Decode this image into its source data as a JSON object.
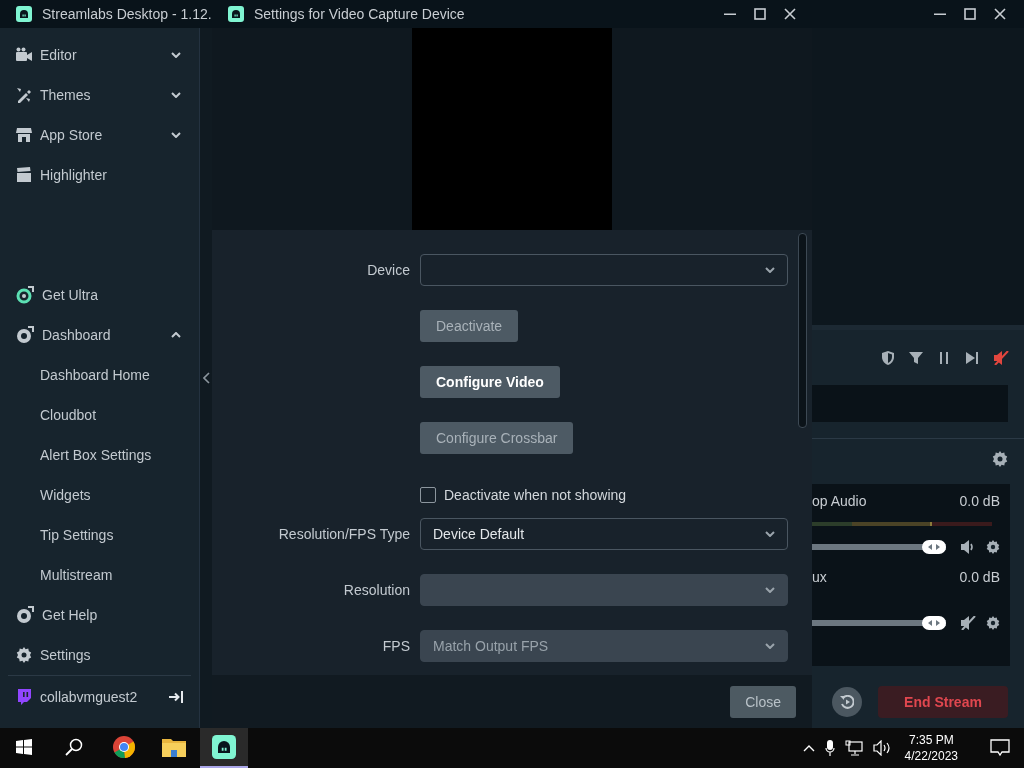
{
  "main_window": {
    "title": "Streamlabs Desktop - 1.12.",
    "sidebar": {
      "top_items": [
        {
          "label": "Editor",
          "expanded": false
        },
        {
          "label": "Themes",
          "expanded": false
        },
        {
          "label": "App Store",
          "expanded": false
        },
        {
          "label": "Highlighter"
        }
      ],
      "bottom_items": [
        {
          "label": "Get Ultra"
        },
        {
          "label": "Dashboard",
          "expanded": true,
          "children": [
            {
              "label": "Dashboard Home"
            },
            {
              "label": "Cloudbot"
            },
            {
              "label": "Alert Box Settings"
            },
            {
              "label": "Widgets"
            },
            {
              "label": "Tip Settings"
            },
            {
              "label": "Multistream"
            }
          ]
        },
        {
          "label": "Get Help"
        },
        {
          "label": "Settings"
        }
      ],
      "account": {
        "name": "collabvmguest2"
      }
    },
    "mixer": {
      "sources": [
        {
          "name": "op Audio",
          "reading": "0.0 dB",
          "level": 1,
          "muted": false
        },
        {
          "name": "ux",
          "reading": "0.0 dB",
          "level": 1,
          "muted": true
        }
      ]
    },
    "end_stream_button": "End Stream"
  },
  "dialog": {
    "title": "Settings for Video Capture Device",
    "fields": [
      {
        "kind": "select",
        "label": "Device",
        "disabled": false
      },
      {
        "kind": "button",
        "label": "Deactivate",
        "disabled": true
      },
      {
        "kind": "button",
        "label": "Configure Video",
        "disabled": false
      },
      {
        "kind": "button",
        "label": "Configure Crossbar",
        "disabled": true
      },
      {
        "kind": "checkbox",
        "label": "Deactivate when not showing",
        "checked": false
      },
      {
        "kind": "select",
        "label": "Resolution/FPS Type",
        "value": "Device Default",
        "disabled": false
      },
      {
        "kind": "select",
        "label": "Resolution",
        "disabled": true
      },
      {
        "kind": "select",
        "label": "FPS",
        "value": "Match Output FPS",
        "disabled": true
      }
    ],
    "close_button": "Close"
  },
  "taskbar": {
    "apps": [
      {
        "kind": "start",
        "selected": false
      },
      {
        "kind": "search",
        "selected": false
      },
      {
        "kind": "browser",
        "selected": false
      },
      {
        "kind": "folder",
        "selected": false
      },
      {
        "kind": "streamlabs",
        "selected": true
      }
    ],
    "clock": {
      "time": "7:35 PM",
      "date": "4/22/2023"
    }
  }
}
